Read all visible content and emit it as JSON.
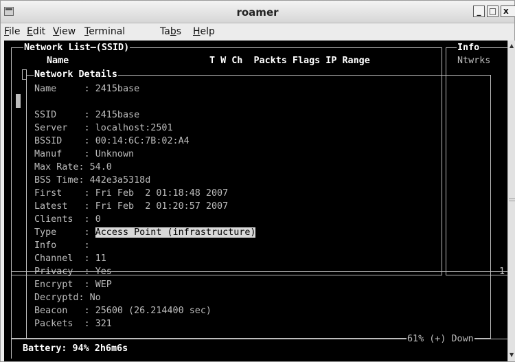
{
  "window": {
    "title": "roamer"
  },
  "menu": [
    {
      "pre": "",
      "key": "F",
      "post": "ile"
    },
    {
      "pre": "",
      "key": "E",
      "post": "dit"
    },
    {
      "pre": "",
      "key": "V",
      "post": "iew"
    },
    {
      "pre": "",
      "key": "T",
      "post": "erminal"
    },
    {
      "pre": "Ta",
      "key": "b",
      "post": "s"
    },
    {
      "pre": "",
      "key": "H",
      "post": "elp"
    }
  ],
  "terminal": {
    "network_list_title": "Network List—(SSID)",
    "info_title": "Info",
    "info_ntwrks": "Ntwrks",
    "col_name": "Name",
    "columns": "T W Ch  Packts Flags IP Range",
    "details_title": "Network Details",
    "details": [
      {
        "label": "Name     ",
        "value": "2415base"
      },
      {
        "label": "SSID     ",
        "value": "2415base"
      },
      {
        "label": "Server   ",
        "value": "localhost:2501"
      },
      {
        "label": "BSSID    ",
        "value": "00:14:6C:7B:02:A4"
      },
      {
        "label": "Manuf    ",
        "value": "Unknown"
      },
      {
        "label": "Max Rate",
        "value": "54.0"
      },
      {
        "label": "BSS Time",
        "value": "442e3a5318d"
      },
      {
        "label": "First    ",
        "value": "Fri Feb  2 01:18:48 2007"
      },
      {
        "label": "Latest   ",
        "value": "Fri Feb  2 01:20:57 2007"
      },
      {
        "label": "Clients  ",
        "value": "0"
      },
      {
        "label": "Type     ",
        "value": "Access Point (infrastructure)"
      },
      {
        "label": "Info     ",
        "value": ""
      },
      {
        "label": "Channel  ",
        "value": "11"
      },
      {
        "label": "Privacy  ",
        "value": "Yes"
      },
      {
        "label": "Encrypt  ",
        "value": "WEP"
      },
      {
        "label": "Decryptd",
        "value": "No"
      },
      {
        "label": "Beacon   ",
        "value": "25600 (26.214400 sec)"
      },
      {
        "label": "Packets  ",
        "value": "321"
      }
    ],
    "side_counter": "1",
    "power_status": "61% (+) Down",
    "battery": "Battery: 94% 2h6m6s"
  }
}
